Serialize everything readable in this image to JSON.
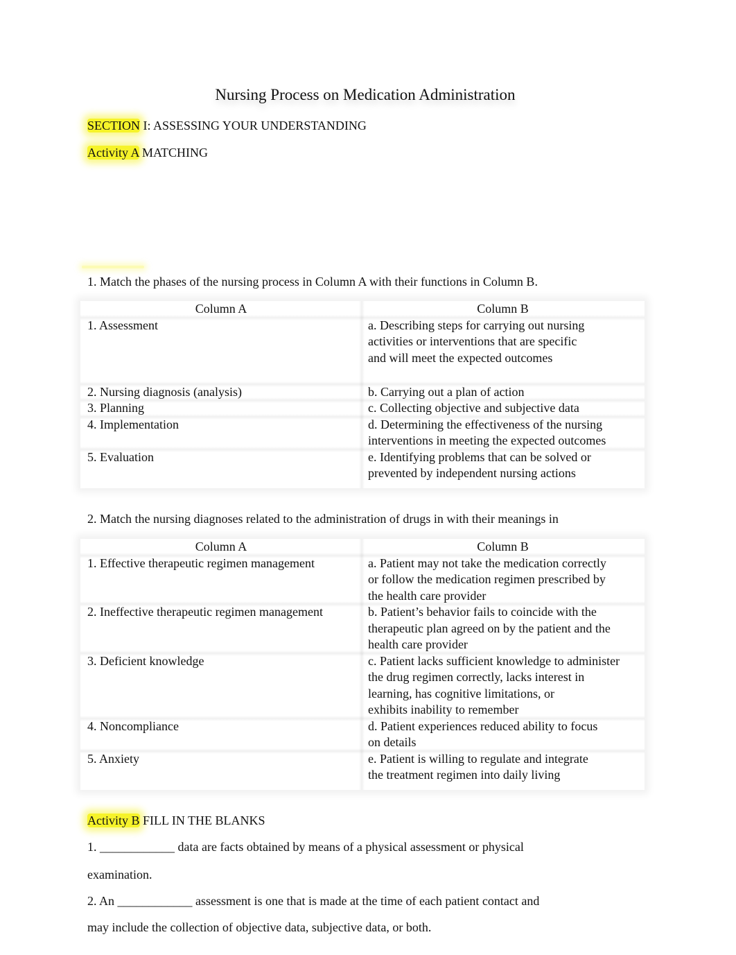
{
  "title": "Nursing Process on Medication Administration",
  "section": {
    "highlighted": "SECTION",
    "rest": " I: ASSESSING YOUR UNDERSTANDING"
  },
  "activity_a": {
    "highlighted": "Activity A",
    "rest": " MATCHING"
  },
  "highlight_color": "#f6f32a",
  "question1": {
    "prompt": "1. Match the phases of the nursing process in Column A with their functions in Column B.",
    "headers": [
      "Column A",
      "Column B"
    ],
    "rows": [
      {
        "a": "1. Assessment",
        "b": [
          "a. Describing steps for carrying out nursing",
          "activities or interventions that are specific",
          "and will meet the expected outcomes"
        ]
      },
      {
        "a": "2. Nursing diagnosis (analysis)",
        "b": [
          "b. Carrying out a plan of action"
        ]
      },
      {
        "a": "3. Planning",
        "b": [
          "c. Collecting objective and subjective data"
        ]
      },
      {
        "a": "4. Implementation",
        "b": [
          "d. Determining the effectiveness of the nursing",
          "interventions in meeting the expected outcomes"
        ]
      },
      {
        "a": "5. Evaluation",
        "b": [
          "e. Identifying problems that can be solved or",
          "prevented by independent nursing actions"
        ]
      }
    ]
  },
  "question2": {
    "prompt": "2. Match the nursing diagnoses related to the administration of drugs in with their meanings in",
    "headers": [
      "Column A",
      "Column B"
    ],
    "rows": [
      {
        "a": "1. Effective therapeutic regimen management",
        "b": [
          "a. Patient may not take the medication correctly",
          "or follow the medication regimen prescribed by",
          "the health care provider"
        ]
      },
      {
        "a": "2. Ineffective therapeutic regimen management",
        "b": [
          "b. Patient’s behavior fails to coincide with the",
          "therapeutic plan agreed on by the patient and the",
          "health care provider"
        ]
      },
      {
        "a": "3. Deficient knowledge",
        "b": [
          "c. Patient lacks sufficient knowledge to administer",
          "the drug regimen correctly, lacks interest in",
          "learning, has cognitive limitations, or",
          "exhibits inability to remember"
        ]
      },
      {
        "a": "4. Noncompliance",
        "b": [
          "d. Patient experiences reduced ability to focus",
          "on details"
        ]
      },
      {
        "a": "5. Anxiety",
        "b": [
          "e. Patient is willing to regulate and integrate",
          "the treatment regimen into daily living"
        ]
      }
    ]
  },
  "activity_b": {
    "highlighted": "Activity B",
    "rest": " FILL IN THE BLANKS"
  },
  "fill_blanks": [
    {
      "prefix": "1. ",
      "blank": "____________",
      "suffix": " data are facts obtained by means of a physical assessment or physical",
      "continuation": "examination."
    },
    {
      "prefix": "2. An ",
      "blank": "____________",
      "suffix": " assessment is one that is made at the time of each patient contact and",
      "continuation": "may include the collection of objective data, subjective data, or both."
    }
  ]
}
